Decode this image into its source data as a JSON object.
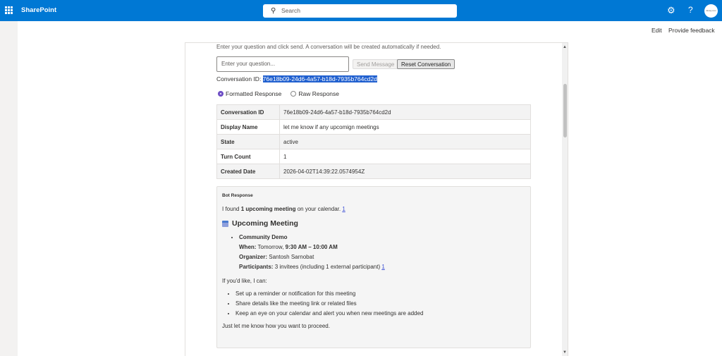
{
  "header": {
    "app": "SharePoint",
    "search_placeholder": "Search",
    "avatar_text": "Glowy.com"
  },
  "commands": {
    "edit": "Edit",
    "feedback": "Provide feedback"
  },
  "form": {
    "intro": "Enter your question and click send. A conversation will be created automatically if needed.",
    "input_placeholder": "Enter your question...",
    "send_label": "Send Message",
    "reset_label": "Reset Conversation",
    "cid_label": "Conversation ID: ",
    "cid_value": "76e18b09-24d6-4a57-b18d-7935b764cd2d",
    "radio_formatted": "Formatted Response",
    "radio_raw": "Raw Response",
    "selected": "Formatted Response"
  },
  "table": [
    {
      "k": "Conversation ID",
      "v": "76e18b09-24d6-4a57-b18d-7935b764cd2d"
    },
    {
      "k": "Display Name",
      "v": "let me know if any upcomign meetings"
    },
    {
      "k": "State",
      "v": "active"
    },
    {
      "k": "Turn Count",
      "v": "1"
    },
    {
      "k": "Created Date",
      "v": "2026-04-02T14:39:22.0574954Z"
    }
  ],
  "bot": {
    "title": "Bot Response",
    "l1a": "I found ",
    "l1b": "1 upcoming meeting",
    "l1c": " on your calendar. ",
    "cite": "1",
    "heading": "Upcoming Meeting",
    "meeting": "Community Demo",
    "when_k": "When:",
    "when_a": " Tomorrow, ",
    "when_b": "9:30 AM – 10:00 AM",
    "org_k": "Organizer:",
    "org_v": " Santosh Sarnobat",
    "part_k": "Participants:",
    "part_v": " 3 invitees (including 1 external participant) ",
    "can": "If you'd like, I can:",
    "options": [
      "Set up a reminder or notification for this meeting",
      "Share details like the meeting link or related files",
      "Keep an eye on your calendar and alert you when new meetings are added"
    ],
    "closing": "Just let me know how you want to proceed."
  }
}
